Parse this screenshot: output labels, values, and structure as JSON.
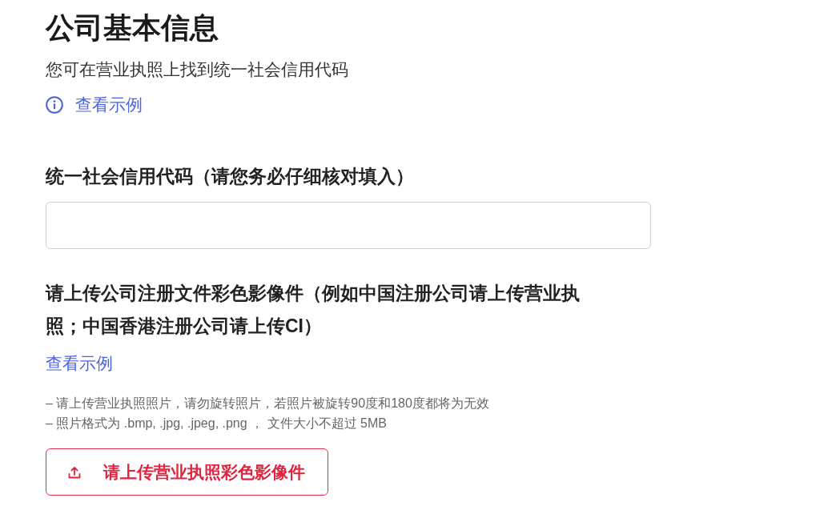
{
  "page_title": "公司基本信息",
  "intro": {
    "text": "您可在营业执照上找到统一社会信用代码",
    "example_link": "查看示例"
  },
  "credit_code_field": {
    "label": "统一社会信用代码（请您务必仔细核对填入）"
  },
  "upload_section": {
    "label": "请上传公司注册文件彩色影像件（例如中国注册公司请上传营业执照；中国香港注册公司请上传CI）",
    "example_link": "查看示例",
    "notes": [
      "– 请上传营业执照照片，请勿旋转照片，若照片被旋转90度和180度都将为无效",
      "– 照片格式为 .bmp, .jpg, .jpeg, .png ， 文件大小不超过 5MB"
    ],
    "upload_button": "请上传营业执照彩色影像件"
  }
}
